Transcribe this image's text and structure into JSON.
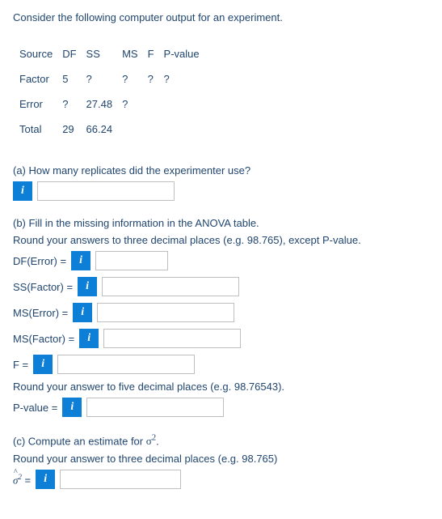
{
  "intro": "Consider the following computer output for an experiment.",
  "table": {
    "headers": [
      "Source",
      "DF",
      "SS",
      "MS",
      "F",
      "P-value"
    ],
    "rows": [
      [
        "Factor",
        "5",
        "?",
        "?",
        "?",
        "?"
      ],
      [
        "Error",
        "?",
        "27.48",
        "?",
        "",
        ""
      ],
      [
        "Total",
        "29",
        "66.24",
        "",
        "",
        ""
      ]
    ]
  },
  "partA": {
    "prompt": "(a) How many replicates did the experimenter use?"
  },
  "partB": {
    "prompt1": "(b) Fill in the missing information in the ANOVA table.",
    "prompt2": "Round your answers to three decimal places (e.g. 98.765), except P-value.",
    "labels": {
      "dfError": "DF(Error) =",
      "ssFactor": "SS(Factor) =",
      "msError": "MS(Error) =",
      "msFactor": "MS(Factor) =",
      "f": "F =",
      "roundFive": "Round your answer to five decimal places (e.g. 98.76543).",
      "pvalue": "P-value ="
    }
  },
  "partC": {
    "prompt1": "(c) Compute an estimate for σ².",
    "prompt2": "Round your answer to three decimal places (e.g. 98.765)",
    "sigmaLabel": "σ̂²  ="
  },
  "chart_data": {
    "type": "table",
    "title": "ANOVA output",
    "columns": [
      "Source",
      "DF",
      "SS",
      "MS",
      "F",
      "P-value"
    ],
    "rows": [
      {
        "Source": "Factor",
        "DF": 5,
        "SS": "?",
        "MS": "?",
        "F": "?",
        "P-value": "?"
      },
      {
        "Source": "Error",
        "DF": "?",
        "SS": 27.48,
        "MS": "?",
        "F": null,
        "P-value": null
      },
      {
        "Source": "Total",
        "DF": 29,
        "SS": 66.24,
        "MS": null,
        "F": null,
        "P-value": null
      }
    ]
  }
}
